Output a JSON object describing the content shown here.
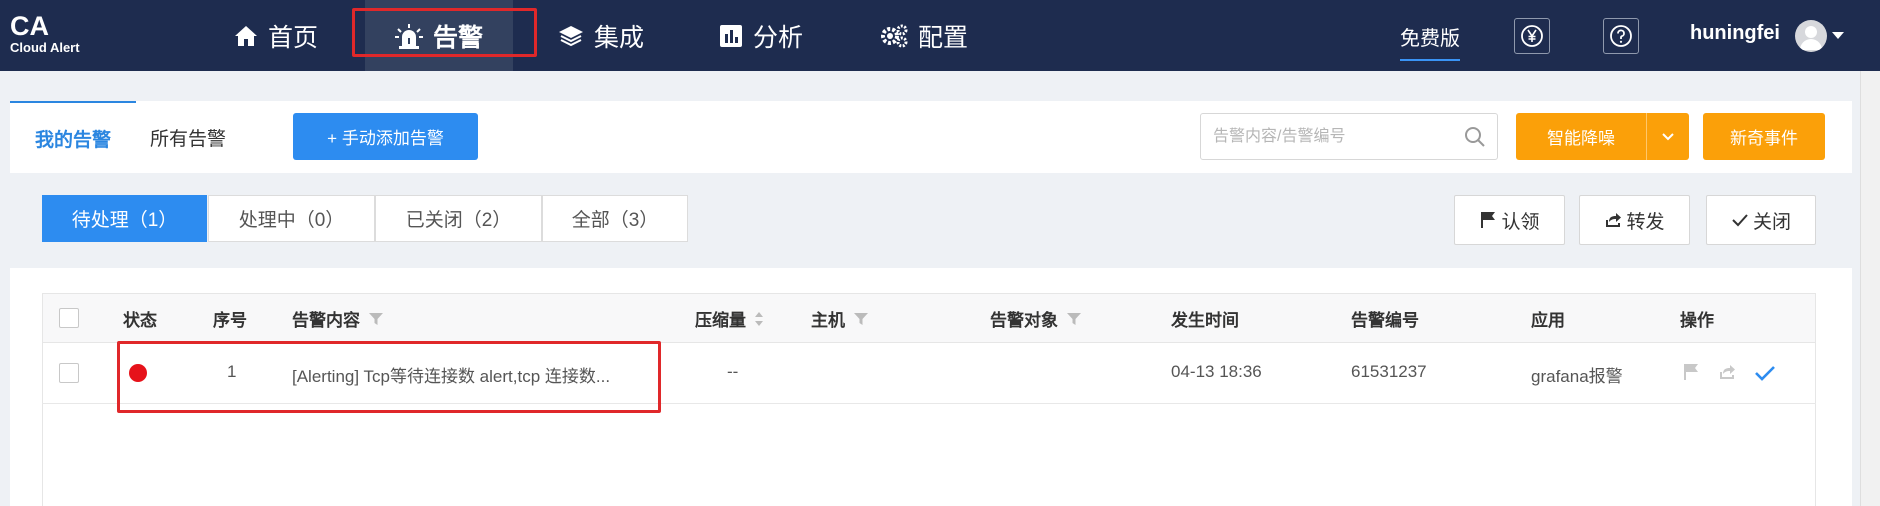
{
  "logo": {
    "title": "CA",
    "subtitle": "Cloud Alert"
  },
  "nav": [
    {
      "label": "首页",
      "icon": "home-icon"
    },
    {
      "label": "告警",
      "icon": "alarm-light-icon",
      "active": true
    },
    {
      "label": "集成",
      "icon": "layers-icon"
    },
    {
      "label": "分析",
      "icon": "bar-chart-icon"
    },
    {
      "label": "配置",
      "icon": "gears-icon"
    }
  ],
  "header": {
    "plan": "免费版",
    "username": "huningfei",
    "icons": [
      "yen-icon",
      "help-icon"
    ]
  },
  "tabs": {
    "my_alerts": "我的告警",
    "all_alerts": "所有告警"
  },
  "toolbar": {
    "add_label": "+ 手动添加告警",
    "search_placeholder": "告警内容/告警编号",
    "noise_label": "智能降噪",
    "novel_label": "新奇事件"
  },
  "filters": [
    "待处理（1）",
    "处理中（0）",
    "已关闭（2）",
    "全部（3）"
  ],
  "actions": {
    "claim": "认领",
    "forward": "转发",
    "close": "关闭"
  },
  "table": {
    "headers": {
      "status": "状态",
      "seq": "序号",
      "content": "告警内容",
      "compress": "压缩量",
      "host": "主机",
      "target": "告警对象",
      "time": "发生时间",
      "id": "告警编号",
      "app": "应用",
      "ops": "操作"
    },
    "rows": [
      {
        "status_color": "#e6121a",
        "seq": "1",
        "content": "[Alerting] Tcp等待连接数 alert,tcp 连接数...",
        "compress": "--",
        "host": "",
        "target": "",
        "time": "04-13 18:36",
        "id": "61531237",
        "app": "grafana报警"
      }
    ]
  },
  "colors": {
    "topbar": "#1e2c4f",
    "primary": "#2d8cf0",
    "orange": "#fba009",
    "highlight": "#e0282a"
  }
}
